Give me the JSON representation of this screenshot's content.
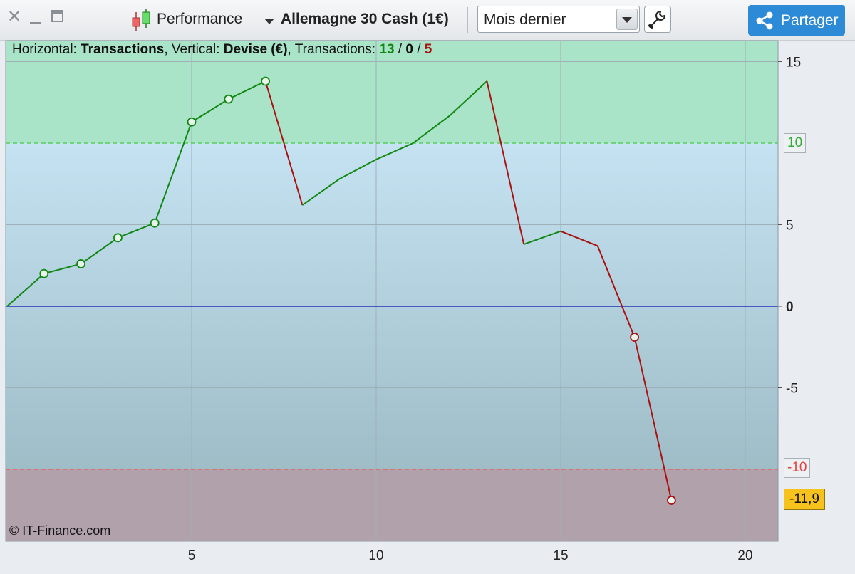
{
  "toolbar": {
    "performance_label": "Performance",
    "instrument_label": "Allemagne 30 Cash (1€)",
    "period_value": "Mois dernier",
    "share_label": "Partager"
  },
  "info": {
    "horizontal_prefix": "Horizontal: ",
    "horizontal_value": "Transactions",
    "vertical_prefix": ", Vertical: ",
    "vertical_value": "Devise (€)",
    "transactions_prefix": ", Transactions: ",
    "tx_winning": "13",
    "tx_sep1": " / ",
    "tx_neutral": "0",
    "tx_sep2": " / ",
    "tx_losing": "5"
  },
  "copyright": "© IT-Finance.com",
  "levels": {
    "upper": "10",
    "lower": "-10",
    "last": "-11,9"
  },
  "colors": {
    "win": "#118811",
    "loss": "#aa1111",
    "zero_line": "#2233bb",
    "upper_zone": "#a9e3c8",
    "lower_zone": "#b1a1aa",
    "last_badge": "#f6c21b"
  },
  "chart_data": {
    "type": "line",
    "xlabel": "Transactions",
    "ylabel": "Devise (€)",
    "xlim": [
      0,
      20.8
    ],
    "ylim": [
      -14,
      16.5
    ],
    "x_ticks": [
      "5",
      "10",
      "15",
      "20"
    ],
    "x_tick_values": [
      5,
      10,
      15,
      20
    ],
    "y_ticks": [
      "15",
      "10",
      "5",
      "0",
      "-5",
      "-10"
    ],
    "y_tick_values": [
      15,
      10,
      5,
      0,
      -5,
      -10
    ],
    "grid": true,
    "upper_level": 10,
    "lower_level": -10,
    "series": [
      {
        "x": [
          0,
          1,
          2,
          3,
          4,
          5,
          6,
          7,
          8,
          9,
          10,
          11,
          12,
          13,
          14,
          15,
          16,
          17,
          18
        ],
        "values": [
          0,
          2.0,
          2.6,
          4.2,
          5.1,
          11.3,
          12.7,
          13.8,
          6.2,
          7.8,
          9.0,
          10.0,
          11.7,
          13.8,
          3.8,
          4.6,
          3.7,
          -1.9,
          -11.9
        ],
        "markers": [
          false,
          true,
          true,
          true,
          true,
          true,
          true,
          true,
          false,
          false,
          false,
          false,
          false,
          false,
          false,
          false,
          false,
          true,
          true
        ]
      }
    ]
  }
}
